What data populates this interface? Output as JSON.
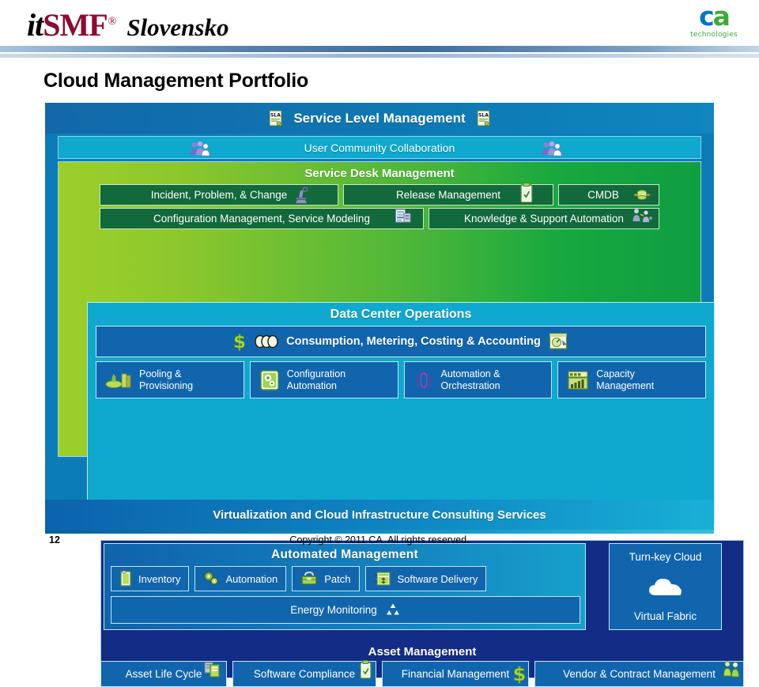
{
  "header": {
    "itsmf_it": "it",
    "itsmf_smf": "SMF",
    "itsmf_reg": "®",
    "itsmf_country": "Slovensko",
    "ca_c": "c",
    "ca_a": "a",
    "ca_tagline": "technologies"
  },
  "slide": {
    "title": "Cloud Management Portfolio",
    "page_number": "12",
    "copyright": "Copyright © 2011 CA. All rights reserved."
  },
  "diagram": {
    "service_level_management": {
      "title": "Service Level Management",
      "icon_left": "sla-icon",
      "icon_right": "sla-icon"
    },
    "user_community_collaboration": {
      "title": "User Community Collaboration",
      "icon_left": "users-group-icon",
      "icon_right": "users-group-icon"
    },
    "service_desk_management": {
      "title": "Service Desk Management",
      "row1": [
        {
          "label": "Incident, Problem, & Change",
          "icon": "microscope-icon"
        },
        {
          "label": "Release Management",
          "icon": "clipboard-check-icon"
        },
        {
          "label": "CMDB",
          "icon": "database-icon"
        }
      ],
      "row2": [
        {
          "label": "Configuration Management, Service Modeling",
          "icon": "server-rack-icon"
        },
        {
          "label": "Knowledge & Support Automation",
          "icon": "people-connect-icon"
        }
      ]
    },
    "data_center_operations": {
      "title": "Data Center Operations",
      "consumption_band": {
        "label": "Consumption, Metering, Costing & Accounting",
        "icon_dollar": "dollar-sign-icon",
        "icon_coins": "coins-icon",
        "icon_right": "metering-chart-icon"
      },
      "tiles": [
        {
          "label_line1": "Pooling &",
          "label_line2": "Provisioning",
          "icon": "pool-server-icon"
        },
        {
          "label_line1": "Configuration",
          "label_line2": "Automation",
          "icon": "gear-config-icon"
        },
        {
          "label_line1": "Automation &",
          "label_line2": "Orchestration",
          "icon": "orchestration-ring-icon"
        },
        {
          "label_line1": "Capacity",
          "label_line2": "Management",
          "icon": "bar-chart-icon"
        }
      ]
    },
    "automated_management": {
      "title": "Automated  Management",
      "tiles": [
        {
          "label": "Inventory",
          "icon": "inventory-doc-icon"
        },
        {
          "label": "Automation",
          "icon": "gears-icon"
        },
        {
          "label": "Patch",
          "icon": "toolbox-icon"
        },
        {
          "label": "Software Delivery",
          "icon": "software-delivery-icon"
        }
      ],
      "energy": {
        "label": "Energy Monitoring",
        "icon": "recycle-icon"
      },
      "turnkey": {
        "top_label": "Turn-key Cloud",
        "bottom_label": "Virtual Fabric",
        "icon": "cloud-icon"
      }
    },
    "asset_management": {
      "title": "Asset Management",
      "boxes": [
        {
          "label": "Asset Life Cycle",
          "icon": "asset-lifecycle-icon"
        },
        {
          "label": "Software Compliance",
          "icon": "clipboard-check-icon"
        },
        {
          "label": "Financial Management",
          "icon": "dollar-sign-icon"
        },
        {
          "label": "Vendor & Contract Management",
          "icon": "people-pair-icon"
        }
      ]
    },
    "consulting_services": {
      "title": "Virtualization and Cloud Infrastructure Consulting Services"
    }
  },
  "colors": {
    "frame_blue": "#0c7cb8",
    "tile_blue": "#1165ad",
    "cyan_panel": "#0fa8cf",
    "green_dark": "#12693c",
    "navy": "#132c86",
    "accent_green": "#8cc63f",
    "brand_red": "#8e0b30",
    "ca_blue": "#0075c9",
    "ca_green": "#3bab35"
  }
}
